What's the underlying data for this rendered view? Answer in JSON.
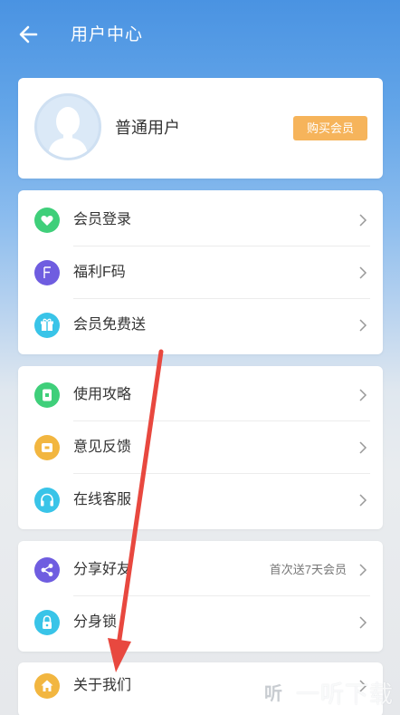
{
  "header": {
    "title": "用户中心"
  },
  "profile": {
    "username": "普通用户",
    "buy_label": "购买会员"
  },
  "groups": [
    [
      {
        "label": "会员登录",
        "icon": "heart-icon",
        "color": "#3fcf7a"
      },
      {
        "label": "福利F码",
        "icon": "letter-f-icon",
        "color": "#6f5de0"
      },
      {
        "label": "会员免费送",
        "icon": "gift-icon",
        "color": "#39c4e8"
      }
    ],
    [
      {
        "label": "使用攻略",
        "icon": "guide-icon",
        "color": "#3fcf7a"
      },
      {
        "label": "意见反馈",
        "icon": "feedback-icon",
        "color": "#f2b640"
      },
      {
        "label": "在线客服",
        "icon": "headset-icon",
        "color": "#39c4e8"
      }
    ],
    [
      {
        "label": "分享好友",
        "icon": "share-icon",
        "color": "#6f5de0",
        "note": "首次送7天会员"
      },
      {
        "label": "分身锁",
        "icon": "lock-icon",
        "color": "#39c4e8"
      }
    ],
    [
      {
        "label": "关于我们",
        "icon": "home-icon",
        "color": "#f2b640"
      }
    ]
  ],
  "watermark": {
    "text": "一听下载",
    "box_glyph": "听"
  },
  "colors": {
    "header_blue": "#4a93e2",
    "buy_orange": "#f6b45b",
    "arrow_red": "#e8483f"
  }
}
